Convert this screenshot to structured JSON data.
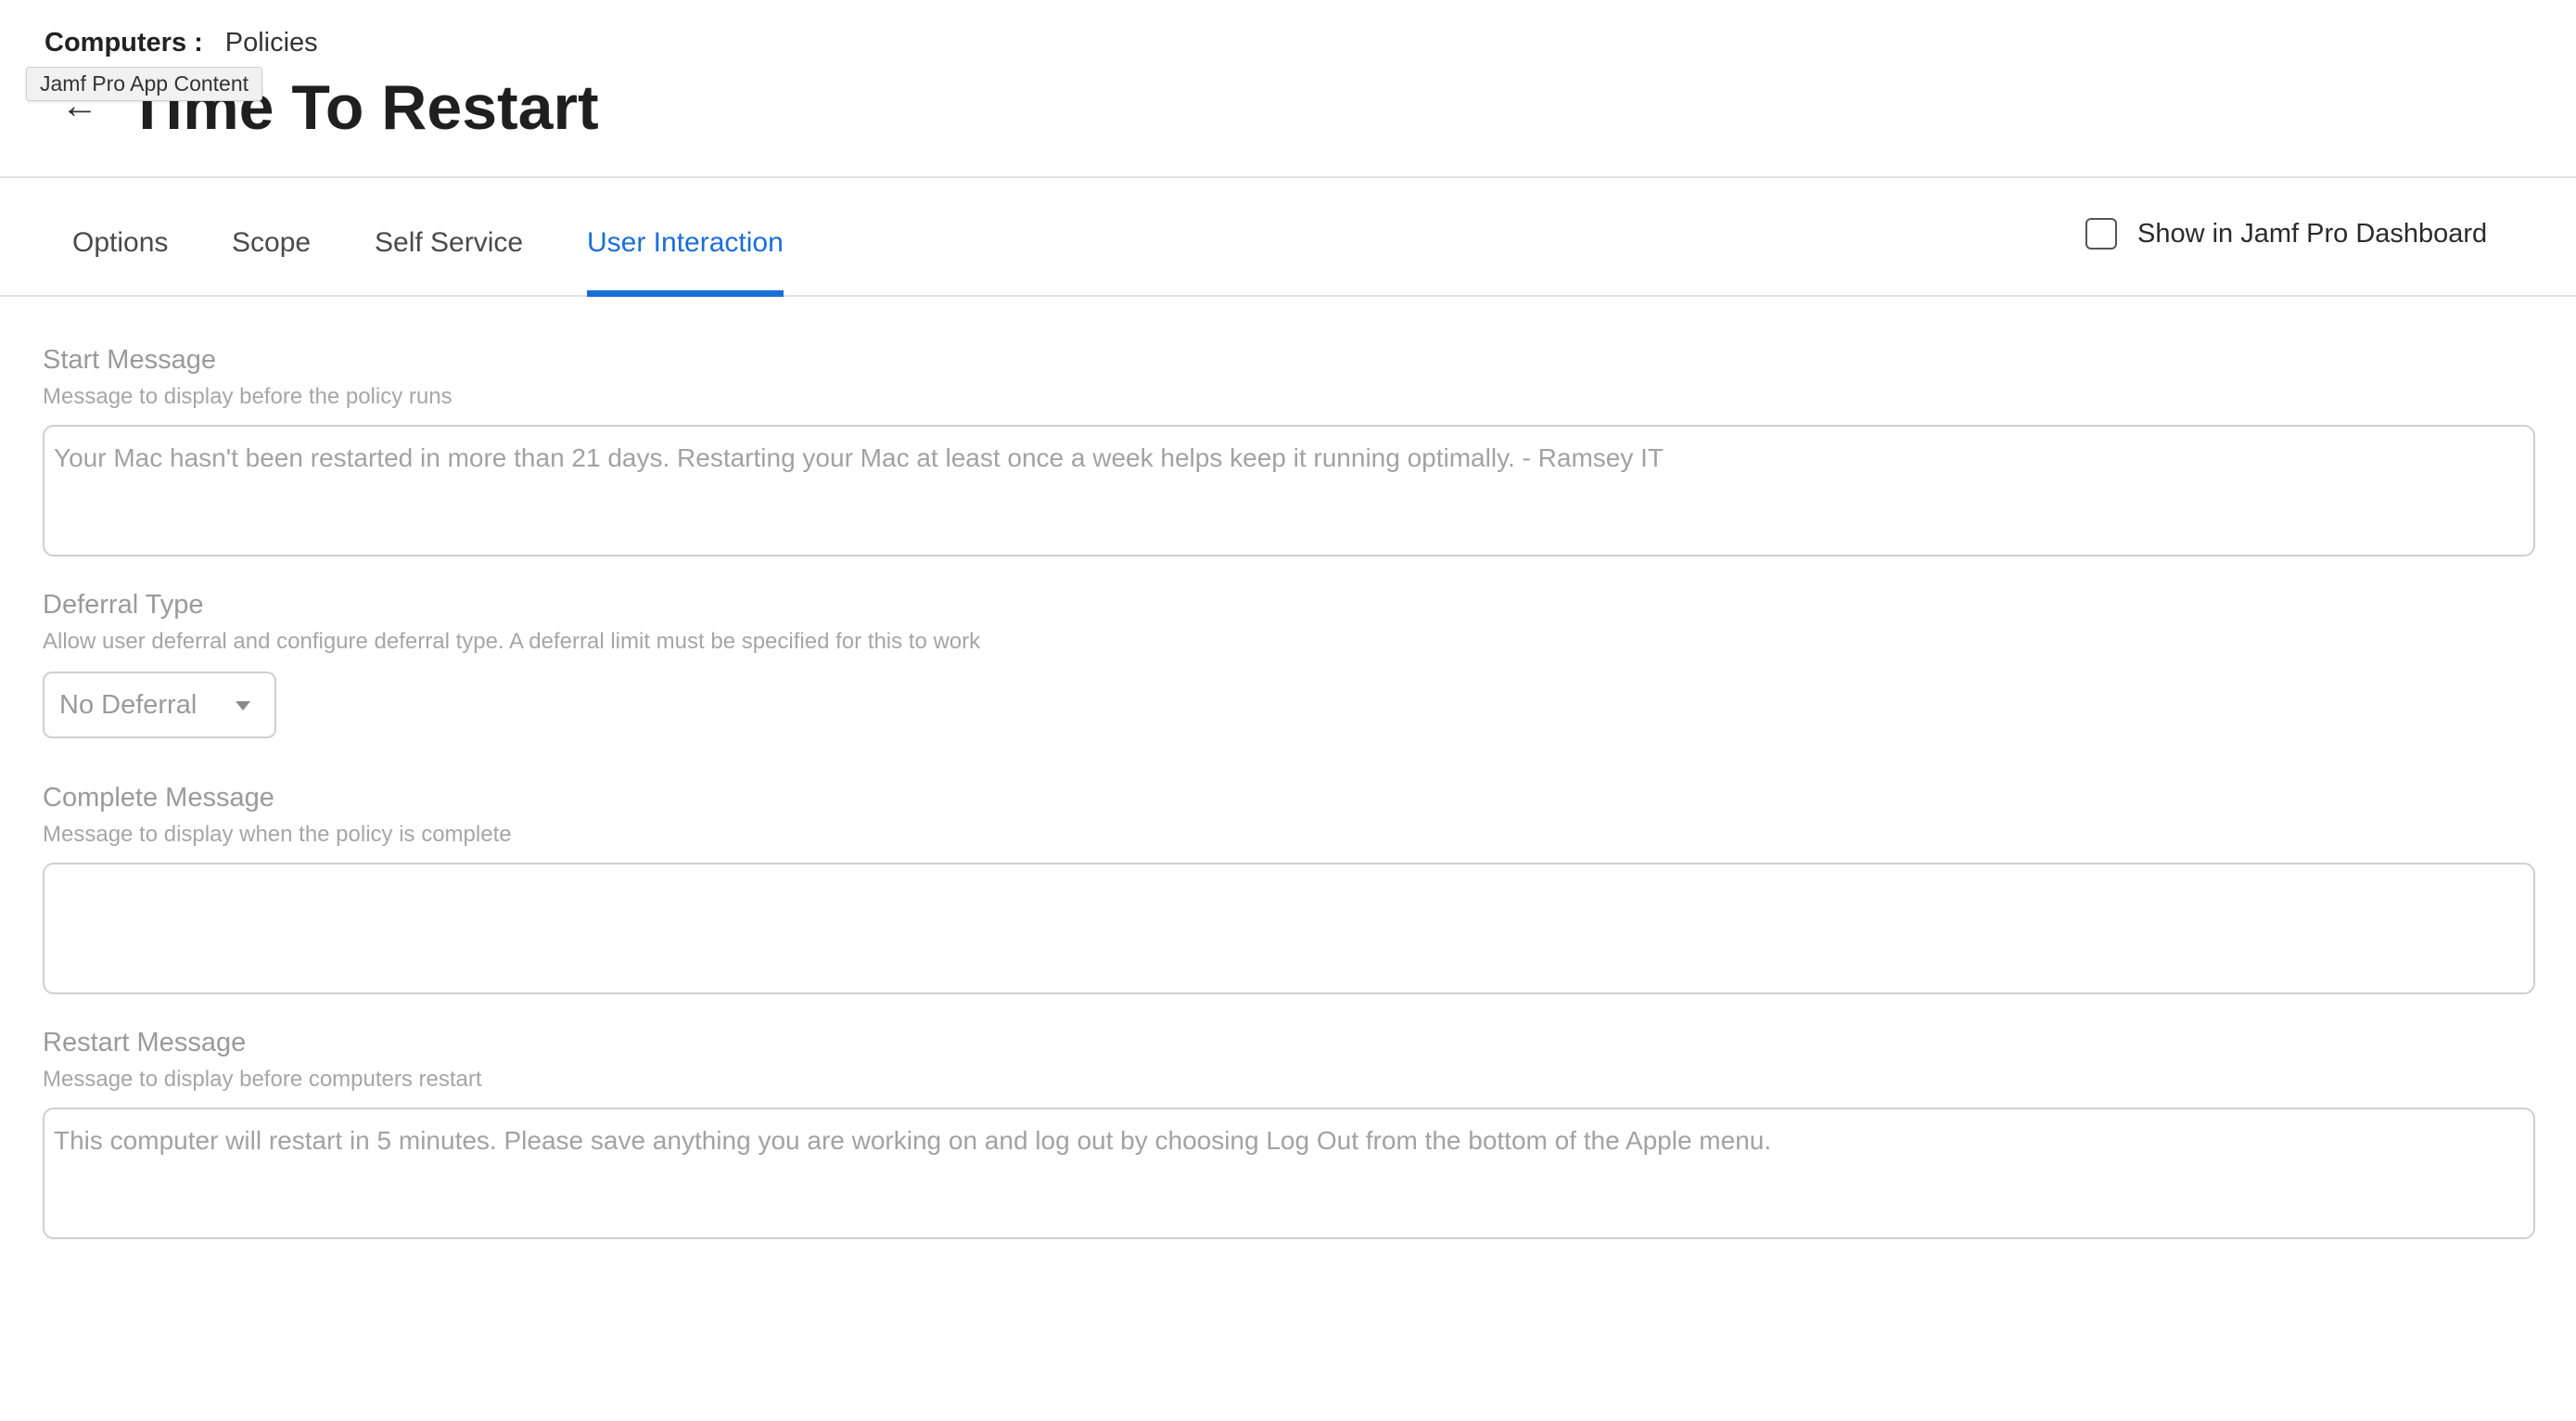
{
  "header": {
    "breadcrumb": {
      "root": "Computers",
      "separator": ":",
      "current": "Policies"
    },
    "back_icon": "back-arrow-icon",
    "back_glyph": "←",
    "title": "Time To Restart",
    "tooltip": "Jamf Pro App Content"
  },
  "tabs": [
    {
      "label": "Options",
      "active": false
    },
    {
      "label": "Scope",
      "active": false
    },
    {
      "label": "Self Service",
      "active": false
    },
    {
      "label": "User Interaction",
      "active": true
    }
  ],
  "dashboard": {
    "label": "Show in Jamf Pro Dashboard",
    "checked": false
  },
  "form": {
    "start_message": {
      "label": "Start Message",
      "help": "Message to display before the policy runs",
      "value": "Your Mac hasn't been restarted in more than 21 days. Restarting your Mac at least once a week helps keep it running optimally. - Ramsey IT"
    },
    "deferral_type": {
      "label": "Deferral Type",
      "help": "Allow user deferral and configure deferral type. A deferral limit must be specified for this to work",
      "selected": "No Deferral"
    },
    "complete_message": {
      "label": "Complete Message",
      "help": "Message to display when the policy is complete",
      "value": ""
    },
    "restart_message": {
      "label": "Restart Message",
      "help": "Message to display before computers restart",
      "value": "This computer will restart in 5 minutes. Please save anything you are working on and log out by choosing Log Out from the bottom of the Apple menu."
    }
  },
  "colors": {
    "accent": "#1a6ed8",
    "border": "#cfcfcf",
    "muted_text": "#9a9a9a"
  }
}
